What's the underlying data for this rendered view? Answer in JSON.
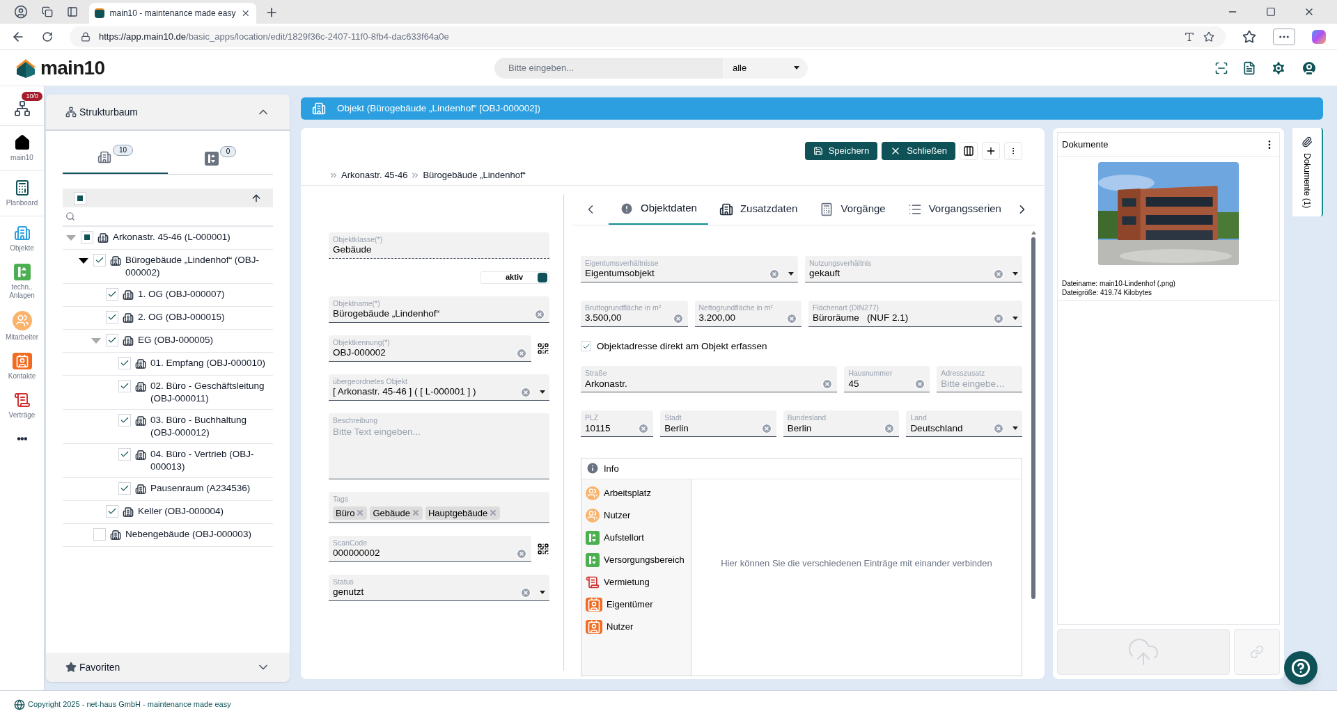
{
  "browser": {
    "tab_title": "main10 - maintenance made easy",
    "url_host": "https://app.main10.de",
    "url_path": "/basic_apps/location/edit/1829f36c-2407-11f0-8fb4-dac633f64a0e"
  },
  "header": {
    "logo_text": "main10",
    "search_placeholder": "Bitte eingeben...",
    "scope": "alle"
  },
  "nav": [
    {
      "kind": "structure",
      "badge": "10/0"
    },
    {
      "kind": "home",
      "label": "main10"
    },
    {
      "kind": "planboard",
      "label": "Planboard"
    },
    {
      "kind": "objects",
      "label": "Objekte"
    },
    {
      "kind": "plants",
      "label": "techn.. Anlagen"
    },
    {
      "kind": "staff",
      "label": "Mitarbeiter"
    },
    {
      "kind": "contacts",
      "label": "Kontakte"
    },
    {
      "kind": "contracts",
      "label": "Verträge"
    },
    {
      "kind": "more",
      "label": "•••"
    }
  ],
  "tree": {
    "title": "Strukturbaum",
    "tabs": [
      {
        "kind": "objects",
        "count": "10",
        "selected": true
      },
      {
        "kind": "plants",
        "count": "0",
        "selected": false
      }
    ],
    "select_all": {
      "checked": false,
      "indeterminate": true
    },
    "nodes": [
      {
        "label": "Arkonastr. 45-46 (L-000001)",
        "checked": false,
        "indeterminate": true,
        "expanded": true,
        "children": [
          {
            "label": "Bürogebäude „Lindenhof“ (OBJ-000002)",
            "checked": true,
            "indeterminate": false,
            "expanded": true,
            "children": [
              {
                "label": "1. OG (OBJ-000007)",
                "checked": true,
                "indeterminate": false
              },
              {
                "label": "2. OG (OBJ-000015)",
                "checked": true,
                "indeterminate": false
              },
              {
                "label": "EG (OBJ-000005)",
                "checked": true,
                "indeterminate": false,
                "expanded": true,
                "children": [
                  {
                    "label": "01. Empfang (OBJ-000010)",
                    "checked": true,
                    "indeterminate": false
                  },
                  {
                    "label": "02. Büro - Geschäftsleitung (OBJ-000011)",
                    "checked": true,
                    "indeterminate": false
                  },
                  {
                    "label": "03. Büro - Buchhaltung (OBJ-000012)",
                    "checked": true,
                    "indeterminate": false
                  },
                  {
                    "label": "04. Büro - Vertrieb (OBJ-000013)",
                    "checked": true,
                    "indeterminate": false
                  },
                  {
                    "label": "Pausenraum (A234536)",
                    "checked": true,
                    "indeterminate": false
                  }
                ]
              },
              {
                "label": "Keller (OBJ-000004)",
                "checked": true,
                "indeterminate": false
              }
            ]
          },
          {
            "label": "Nebengebäude (OBJ-000003)",
            "checked": false,
            "indeterminate": false
          }
        ]
      }
    ],
    "favorites": "Favoriten"
  },
  "main": {
    "title": "Objekt (Bürogebäude „Lindenhof“ [OBJ-000002])",
    "actions": [
      {
        "kind": "save",
        "label": "Speichern"
      },
      {
        "kind": "close",
        "label": "Schließen"
      }
    ],
    "breadcrumb": [
      "Arkonastr. 45-46",
      "Bürogebäude „Lindenhof“"
    ],
    "left_fields": [
      {
        "kind": "static",
        "label": "Objektklasse(*)",
        "value": "Gebäude"
      },
      {
        "kind": "toggle",
        "label": "aktiv",
        "on": true
      },
      {
        "kind": "text",
        "label": "Objektname(*)",
        "value": "Bürogebäude „Lindenhof“",
        "clear": true
      },
      {
        "kind": "text",
        "label": "Objektkennung(*)",
        "value": "OBJ-000002",
        "clear": true,
        "qr": true
      },
      {
        "kind": "select",
        "label": "übergeordnetes Objekt",
        "value": "[ Arkonastr. 45-46 ] ( [ L-000001 ] )",
        "clear": true
      },
      {
        "kind": "textarea",
        "label": "Beschreibung",
        "placeholder": "Bitte Text eingeben..."
      },
      {
        "kind": "tags",
        "label": "Tags",
        "tags": [
          "Büro",
          "Gebäude",
          "Hauptgebäude"
        ]
      },
      {
        "kind": "text",
        "label": "ScanCode",
        "value": "000000002",
        "clear": true,
        "qr": true
      },
      {
        "kind": "select",
        "label": "Status",
        "value": "genutzt",
        "clear": true
      }
    ],
    "tabs": [
      {
        "kind": "alert",
        "label": "Objektdaten",
        "selected": true
      },
      {
        "kind": "building",
        "label": "Zusatzdaten",
        "selected": false
      },
      {
        "kind": "calc",
        "label": "Vorgänge",
        "selected": false
      },
      {
        "kind": "list",
        "label": "Vorgangsserien",
        "selected": false
      }
    ],
    "rows": [
      [
        {
          "kind": "select",
          "label": "Eigentumsverhältnisse",
          "value": "Eigentumsobjekt",
          "clear": true
        },
        {
          "kind": "select",
          "label": "Nutzungsverhältnis",
          "value": "gekauft",
          "clear": true
        }
      ],
      [
        {
          "kind": "text",
          "label": "Bruttogrundfläche in m²",
          "value": "3.500,00",
          "clear": true
        },
        {
          "kind": "text",
          "label": "Nettogrundfläche in m²",
          "value": "3.200,00",
          "clear": true
        },
        {
          "kind": "select",
          "label": "Flächenart (DIN277)",
          "value": "Büroräume   (NUF 2.1)",
          "clear": true
        }
      ],
      [
        {
          "kind": "checkbox",
          "label": "Objektadresse direkt am Objekt erfassen",
          "checked": true
        }
      ],
      [
        {
          "kind": "text",
          "label": "Straße",
          "value": "Arkonastr.",
          "clear": true
        },
        {
          "kind": "text",
          "label": "Hausnummer",
          "value": "45",
          "clear": true
        },
        {
          "kind": "text",
          "label": "Adresszusatz",
          "placeholder": "Bitte eingebe…"
        }
      ],
      [
        {
          "kind": "text",
          "label": "PLZ",
          "value": "10115",
          "clear": true
        },
        {
          "kind": "text",
          "label": "Stadt",
          "value": "Berlin",
          "clear": true
        },
        {
          "kind": "text",
          "label": "Bundesland",
          "value": "Berlin",
          "clear": true
        },
        {
          "kind": "select",
          "label": "Land",
          "value": "Deutschland",
          "clear": true
        }
      ]
    ],
    "relations": {
      "header": {
        "kind": "info",
        "label": "Info"
      },
      "items": [
        {
          "kind": "workplace",
          "label": "Arbeitsplatz"
        },
        {
          "kind": "workplace",
          "label": "Nutzer"
        },
        {
          "kind": "plant",
          "label": "Aufstellort"
        },
        {
          "kind": "plant",
          "label": "Versorgungsbereich"
        },
        {
          "kind": "contract",
          "label": "Vermietung"
        },
        {
          "kind": "contact",
          "label": "Eigentümer"
        },
        {
          "kind": "contact",
          "label": "Nutzer"
        }
      ],
      "hint": "Hier können Sie die verschiedenen Einträge mit einander verbinden"
    }
  },
  "documents": {
    "title": "Dokumente",
    "file_name": "Dateiname: main10-Lindenhof (.png)",
    "file_size": "Dateigröße: 419.74 Kilobytes",
    "side_tab": "Dokumente (1)"
  },
  "footer": "Copyright 2025 - net-haus GmbH - maintenance made easy"
}
